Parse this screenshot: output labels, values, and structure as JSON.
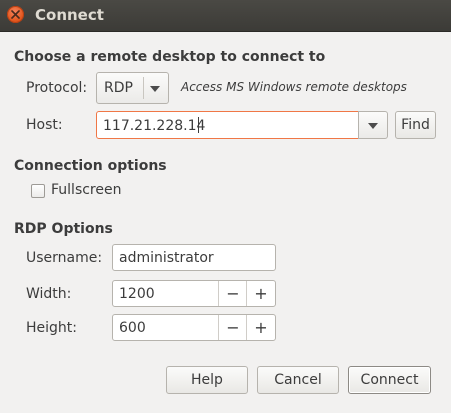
{
  "window": {
    "title": "Connect"
  },
  "remote": {
    "heading": "Choose a remote desktop to connect to",
    "protocol_label": "Protocol:",
    "protocol_value": "RDP",
    "protocol_hint": "Access MS Windows remote desktops",
    "host_label": "Host:",
    "host_value": "117.21.228.14",
    "find_label": "Find"
  },
  "connection": {
    "heading": "Connection options",
    "fullscreen_label": "Fullscreen",
    "fullscreen_checked": false
  },
  "rdp": {
    "heading": "RDP Options",
    "username_label": "Username:",
    "username_value": "administrator",
    "width_label": "Width:",
    "width_value": "1200",
    "height_label": "Height:",
    "height_value": "600",
    "minus_glyph": "−",
    "plus_glyph": "+"
  },
  "buttons": {
    "help": "Help",
    "cancel": "Cancel",
    "connect": "Connect"
  },
  "colors": {
    "titlebar": "#3c3b37",
    "close_button": "#e3581f",
    "focus_border": "#f07746",
    "window_bg": "#f2f1f0"
  }
}
